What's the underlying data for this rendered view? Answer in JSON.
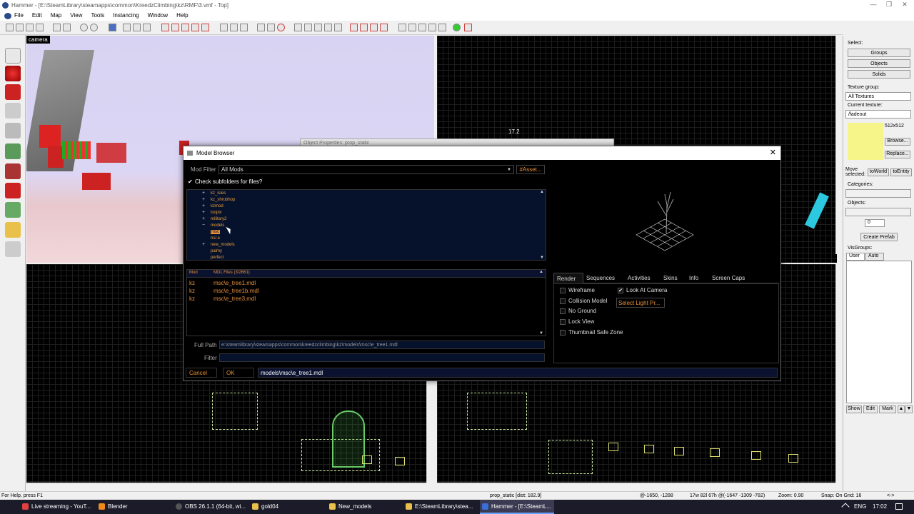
{
  "window": {
    "title": "Hammer - [E:\\SteamLibrary\\steamapps\\common\\KreedzClimbing\\kz\\RMF\\3.vmf - Top]",
    "controls": [
      "—",
      "❐",
      "✕"
    ]
  },
  "menu": [
    "File",
    "Edit",
    "Map",
    "View",
    "Tools",
    "Instancing",
    "Window",
    "Help"
  ],
  "viewports": {
    "camera_label": "camera",
    "topright_readout": "17.2"
  },
  "behind_dialog_title": "Object Properties: prop_static",
  "model_browser": {
    "title": "Model Browser",
    "close": "✕",
    "mod_filter_label": "Mod Filter",
    "mod_filter_value": "All Mods",
    "asset_button": "#Asset...",
    "check_subfolders": "Check subfolders for files?",
    "tree": [
      {
        "label": "kz_isles",
        "expand": "+"
      },
      {
        "label": "kz_shrubhop",
        "expand": "+"
      },
      {
        "label": "kzmod",
        "expand": "+"
      },
      {
        "label": "loopix",
        "expand": "+"
      },
      {
        "label": "military2",
        "expand": "+"
      },
      {
        "label": "models",
        "expand": "−"
      },
      {
        "label": "msc",
        "expand": "",
        "selected": true
      },
      {
        "label": "ns/.e",
        "expand": ""
      },
      {
        "label": "new_models",
        "expand": "+"
      },
      {
        "label": "palmy",
        "expand": ""
      },
      {
        "label": "perfect",
        "expand": ""
      }
    ],
    "files_header_mod": "Mod",
    "files_header_files": "MDL Files (3/2661)",
    "files": [
      {
        "mod": "kz",
        "path": "msc\\e_tree1.mdl"
      },
      {
        "mod": "kz",
        "path": "msc\\e_tree1b.mdl"
      },
      {
        "mod": "kz",
        "path": "msc\\e_tree3.mdl"
      }
    ],
    "full_path_label": "Full Path",
    "full_path_value": "e:\\steamlibrary\\steamapps\\common\\kreedzclimbing\\kz\\models\\msc\\e_tree1.mdl",
    "filter_label": "Filter",
    "filter_value": "",
    "cancel": "Cancel",
    "ok": "OK",
    "selected_model": "models\\msc\\e_tree1.mdl",
    "tabs": [
      "Render",
      "Sequences",
      "Activities",
      "Skins",
      "Info",
      "Screen Caps"
    ],
    "render_options": [
      {
        "label": "Wireframe",
        "checked": false
      },
      {
        "label": "Collision Model",
        "checked": false
      },
      {
        "label": "No Ground",
        "checked": false
      },
      {
        "label": "Lock View",
        "checked": false
      },
      {
        "label": "Thumbnail Safe Zone",
        "checked": false
      }
    ],
    "look_at_camera": {
      "label": "Look At Camera",
      "checked": true
    },
    "select_light": "Select Light Pr..."
  },
  "right_panel": {
    "select_label": "Select:",
    "buttons": [
      "Groups",
      "Objects",
      "Solids"
    ],
    "texture_group_label": "Texture group:",
    "texture_group_value": "All Textures",
    "current_texture_label": "Current texture:",
    "current_texture_value": "/fadeout",
    "texture_size": "512x512",
    "browse": "Browse...",
    "replace": "Replace...",
    "move_selected": "Move selected:",
    "to_world": "toWorld",
    "to_entity": "toEntity",
    "categories_label": "Categories:",
    "objects_label": "Objects:",
    "spin_value": "0",
    "create_prefab": "Create Prefab",
    "visgroups_label": "VisGroups:",
    "vis_tabs": [
      "User",
      "Auto"
    ],
    "bottom_buttons": [
      "Show",
      "Edit",
      "Mark"
    ],
    "texture_color": "#f5f58a"
  },
  "status": {
    "help": "For Help, press F1",
    "entity": "prop_static  [dist: 182.9]",
    "coords": "@-1650, -1288",
    "size": "17w 82l 67h @(-1647 -1309 -782)",
    "zoom": "Zoom: 0.90",
    "snap": "Snap: On Grid: 16",
    "arrows": "<->"
  },
  "taskbar": {
    "items": [
      {
        "label": "Live streaming - YouT...",
        "color": "#e04040"
      },
      {
        "label": "Blender",
        "color": "#f08a1c"
      },
      {
        "label": "OBS 26.1.1 (64-bit, wi...",
        "color": "#444"
      },
      {
        "label": "gold04",
        "color": "#e8c04a"
      },
      {
        "label": "New_models",
        "color": "#e8c04a"
      },
      {
        "label": "E:\\SteamLibrary\\stea...",
        "color": "#e8c04a"
      },
      {
        "label": "Hammer - [E:\\SteamL...",
        "color": "#3a6fd8"
      }
    ],
    "lang": "ENG",
    "time": "17:02"
  }
}
